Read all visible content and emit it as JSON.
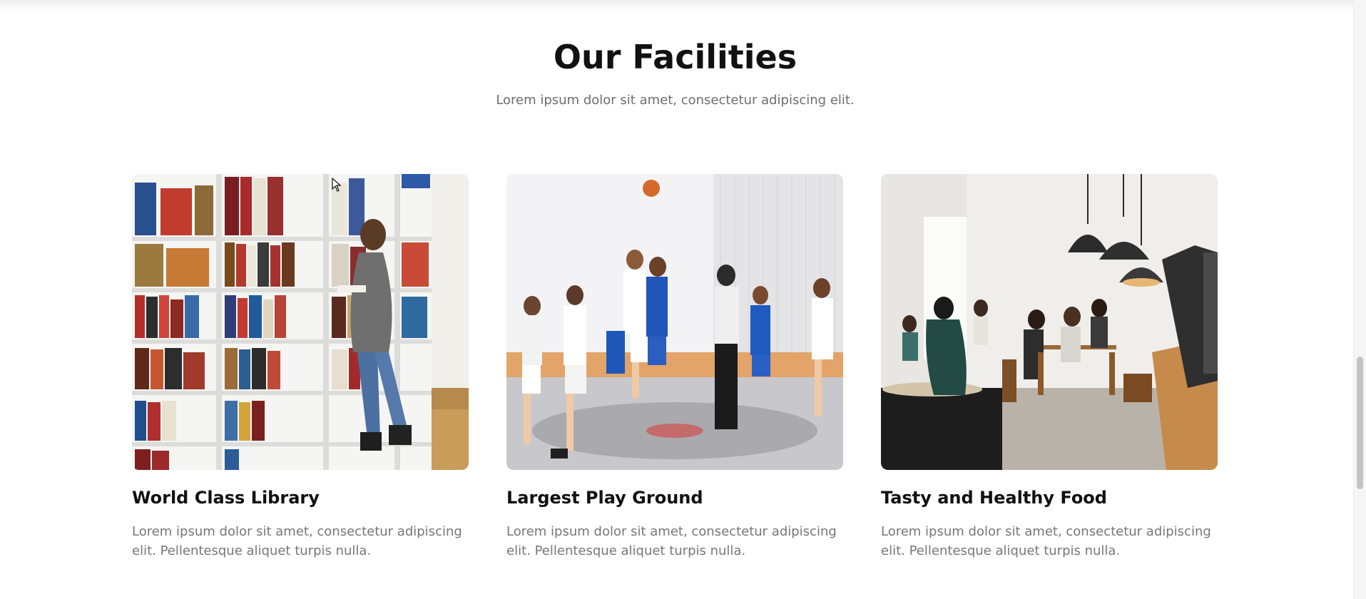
{
  "facilities": {
    "title": "Our Facilities",
    "subtitle": "Lorem ipsum dolor sit amet, consectetur adipiscing elit.",
    "cards": [
      {
        "title": "World Class Library",
        "text": "Lorem ipsum dolor sit amet, consectetur adipiscing elit. Pellentesque aliquet turpis nulla.",
        "image": "library-photo"
      },
      {
        "title": "Largest Play Ground",
        "text": "Lorem ipsum dolor sit amet, consectetur adipiscing elit. Pellentesque aliquet turpis nulla.",
        "image": "basketball-photo"
      },
      {
        "title": "Tasty and Healthy Food",
        "text": "Lorem ipsum dolor sit amet, consectetur adipiscing elit. Pellentesque aliquet turpis nulla.",
        "image": "cafe-photo"
      }
    ]
  },
  "colors": {
    "heading": "#111111",
    "body_text": "#777777",
    "background": "#ffffff"
  }
}
